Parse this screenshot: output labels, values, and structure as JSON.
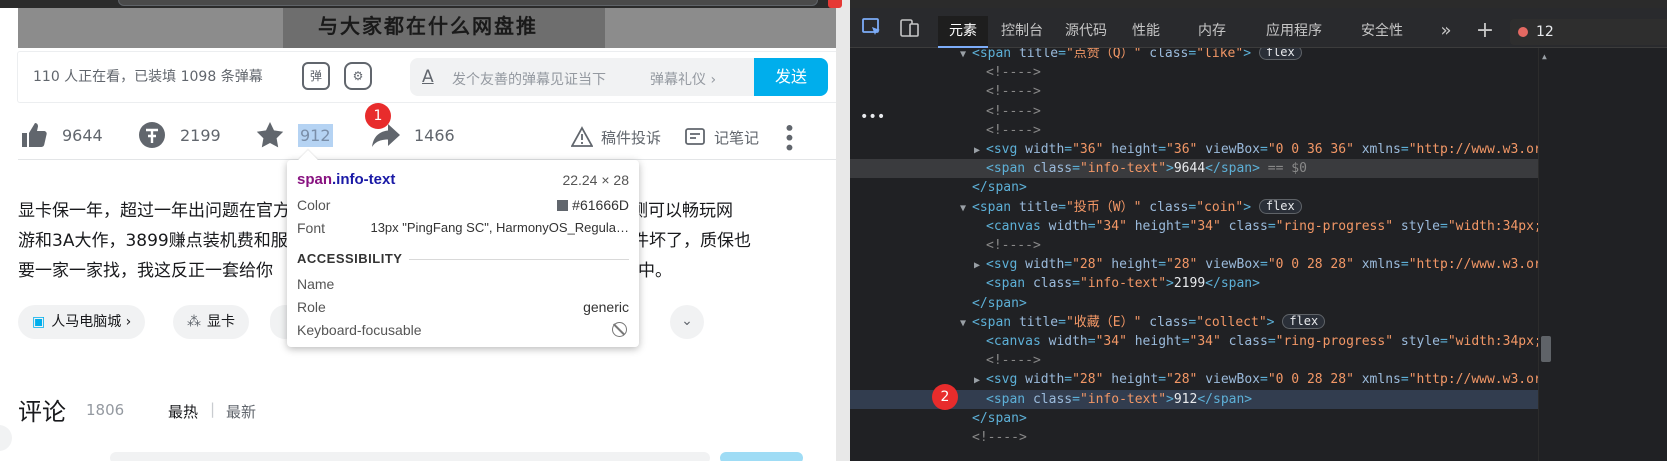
{
  "video": {
    "caption": "与大家都在什么网盘推",
    "danmu_stat": "110 人正在看，已装填 1098 条弹幕",
    "danmu_toggle_icon": "弹",
    "danmu_placeholder": "发个友善的弹幕见证当下",
    "danmu_etiquette": "弹幕礼仪 ›",
    "send_label": "发送"
  },
  "toolbar": {
    "like": "9644",
    "coin": "2199",
    "collect": "912",
    "share": "1466",
    "report": "稿件投诉",
    "note": "记笔记",
    "badge1": "1"
  },
  "description": {
    "line1_left": "显卡保一年，超过一年出问题在官方",
    "line1_right": "保，实测可以畅玩网",
    "line2_left": "游和3A大作，3899赚点装机费和服",
    "line2_right": "采散件坏了，质保也",
    "line3_left": "要一家一家找，我这反正一套给你",
    "line3_right": "中。"
  },
  "tags": [
    {
      "icon": "▣",
      "label": "人马电脑城 ›"
    },
    {
      "icon": "⁂",
      "label": "显卡"
    }
  ],
  "comments": {
    "title": "评论",
    "count": "1806",
    "hot": "最热",
    "separator": "|",
    "newest": "最新"
  },
  "tooltip": {
    "tag": "span",
    "cls": ".info-text",
    "size": "22.24 × 28",
    "color_label": "Color",
    "color_value": "#61666D",
    "font_label": "Font",
    "font_value": "13px \"PingFang SC\", HarmonyOS_Regula…",
    "accessibility": "ACCESSIBILITY",
    "name_label": "Name",
    "role_label": "Role",
    "role_value": "generic",
    "focus_label": "Keyboard-focusable"
  },
  "devtools": {
    "tabs": [
      "元素",
      "控制台",
      "源代码",
      "性能",
      "内存",
      "应用程序",
      "安全性"
    ],
    "more": "»",
    "add": "+",
    "error_count": "12",
    "badge2": "2",
    "dots": "•••"
  },
  "dom_lines": [
    {
      "indent": 0,
      "tw": "▼",
      "tag": "span",
      "attrs": [
        [
          "title",
          "\"点赞（Q）\""
        ],
        [
          "class",
          "\"like\""
        ]
      ],
      "close": ">",
      "pill": "flex"
    },
    {
      "indent": 1,
      "comment": "<!---->"
    },
    {
      "indent": 1,
      "comment": "<!---->"
    },
    {
      "indent": 1,
      "comment": "<!---->"
    },
    {
      "indent": 1,
      "comment": "<!---->"
    },
    {
      "indent": 1,
      "tw": "▶",
      "tag": "svg",
      "attrs": [
        [
          "width",
          "\"36\""
        ],
        [
          "height",
          "\"36\""
        ],
        [
          "viewBox",
          "\"0 0 36 36\""
        ],
        [
          "xmlns",
          "\"http://www.w3.or"
        ]
      ],
      "close": ""
    },
    {
      "indent": 1,
      "tag": "span",
      "attrs": [
        [
          "class",
          "\"info-text\""
        ]
      ],
      "close": ">",
      "text": "9644",
      "end": "</span>",
      "eq": " == $0",
      "hl": true
    },
    {
      "indent": 0,
      "end_only": "</span>"
    },
    {
      "indent": 0,
      "tw": "▼",
      "tag": "span",
      "attrs": [
        [
          "title",
          "\"投币（W）\""
        ],
        [
          "class",
          "\"coin\""
        ]
      ],
      "close": ">",
      "pill": "flex"
    },
    {
      "indent": 1,
      "tag": "canvas",
      "attrs": [
        [
          "width",
          "\"34\""
        ],
        [
          "height",
          "\"34\""
        ],
        [
          "class",
          "\"ring-progress\""
        ],
        [
          "style",
          "\"width:34px;"
        ]
      ],
      "close": ""
    },
    {
      "indent": 1,
      "comment": "<!---->"
    },
    {
      "indent": 1,
      "tw": "▶",
      "tag": "svg",
      "attrs": [
        [
          "width",
          "\"28\""
        ],
        [
          "height",
          "\"28\""
        ],
        [
          "viewBox",
          "\"0 0 28 28\""
        ],
        [
          "xmlns",
          "\"http://www.w3.or"
        ]
      ],
      "close": ""
    },
    {
      "indent": 1,
      "tag": "span",
      "attrs": [
        [
          "class",
          "\"info-text\""
        ]
      ],
      "close": ">",
      "text": "2199",
      "end": "</span>"
    },
    {
      "indent": 0,
      "end_only": "</span>"
    },
    {
      "indent": 0,
      "tw": "▼",
      "tag": "span",
      "attrs": [
        [
          "title",
          "\"收藏（E）\""
        ],
        [
          "class",
          "\"collect\""
        ]
      ],
      "close": ">",
      "pill": "flex"
    },
    {
      "indent": 1,
      "tag": "canvas",
      "attrs": [
        [
          "width",
          "\"34\""
        ],
        [
          "height",
          "\"34\""
        ],
        [
          "class",
          "\"ring-progress\""
        ],
        [
          "style",
          "\"width:34px;"
        ]
      ],
      "close": ""
    },
    {
      "indent": 1,
      "comment": "<!---->"
    },
    {
      "indent": 1,
      "tw": "▶",
      "tag": "svg",
      "attrs": [
        [
          "width",
          "\"28\""
        ],
        [
          "height",
          "\"28\""
        ],
        [
          "viewBox",
          "\"0 0 28 28\""
        ],
        [
          "xmlns",
          "\"http://www.w3.or"
        ]
      ],
      "close": ""
    },
    {
      "indent": 1,
      "tag": "span",
      "attrs": [
        [
          "class",
          "\"info-text\""
        ]
      ],
      "close": ">",
      "text": "912",
      "end": "</span>",
      "sel": true
    },
    {
      "indent": 0,
      "end_only": "</span>"
    },
    {
      "indent": 0,
      "comment": "<!---->"
    }
  ]
}
